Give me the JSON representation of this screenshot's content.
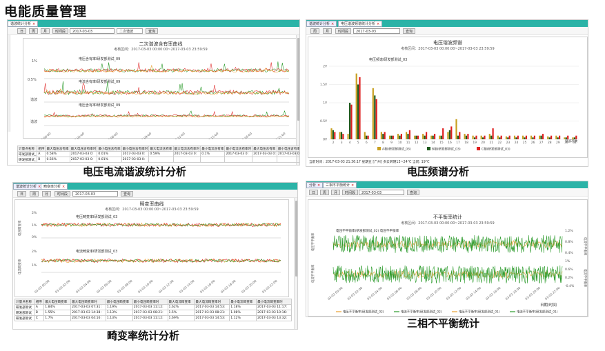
{
  "page_title": "电能质量管理",
  "captions": {
    "p1": "电压电流谐波统计分析",
    "p2": "电压频谱分析",
    "p3": "畸变率统计分析",
    "p4": "三相不平衡统计"
  },
  "toolbar": {
    "day": "日",
    "week": "周",
    "month": "月",
    "period": "时间段",
    "date": "2017-03-03",
    "harmonic_select": "二次谐波",
    "query": "查询"
  },
  "p1": {
    "tabs": [
      "谐波统计分析"
    ],
    "title": "二次谐波含有率曲线",
    "subtitle": "考核区间：2017-03-03 00:00:00~2017-03-03 23:59:59",
    "sub1": "电压含有率I研发部测试_09",
    "sub2": "电流含有率I研发部测试_09",
    "sub3": "电压含有率I研发部测试_09",
    "yticks1": [
      "1%",
      "0.5%"
    ],
    "ylabel2": "谐波",
    "ylabel3": "谐波",
    "xticks": [
      "03-03 00:00",
      "03-03 03:00",
      "03-03 06:00",
      "03-03 09:00",
      "03-03 12:00",
      "03-03 15:00",
      "03-03 18:00",
      "03-03 21:00"
    ],
    "table_headers": [
      "计量点名称",
      "相序",
      "最大电压含有率",
      "最大电压含有率时",
      "最小电压含有率",
      "最小电压含有率时",
      "最大电流含有率",
      "最大电流含有率时",
      "最小电流含有率",
      "最小电流含有率时",
      "最大电压含有率",
      "最小电压含有率"
    ],
    "rows": [
      [
        "研发部测试_",
        "A",
        "0.58%",
        "2017-03-03 0:",
        "0.01%",
        "2017-03-03 0:",
        "0.59%",
        "2017-03-03 0:",
        "0.1%",
        "2017-03-03 0:",
        "2017-03-03 0:",
        "2017-03-03 0:"
      ],
      [
        "研发部测试_",
        "B",
        "0.56%",
        "2017-03-03 0:",
        "0.01%",
        "2017-03-03 0:",
        "",
        "",
        "",
        "",
        "",
        ""
      ]
    ]
  },
  "p2": {
    "tabs": [
      "谐波统计分析",
      "电压谐波频谱统计分析"
    ],
    "title": "电压谐波频谱",
    "subtitle": "考核区间：2017-03-03 00:00:00~2017-03-03 23:59:59",
    "series_label": "电压频谱I研发部测试_03",
    "status": "当前时间：2017-03-03 21:36:17 星期五    [广州] 多云转阴13~24°C 当前: 19°C",
    "xlabel": "谐波次数",
    "legend": [
      "A相(研发部测试_03)",
      "B相(研发部测试_03)",
      "C相(研发部测试_03)"
    ]
  },
  "p3": {
    "tabs": [
      "谐波统计分析",
      "畸变率分析"
    ],
    "title": "畸变率曲线",
    "subtitle": "考核区间：2017-03-03 00:00:00~2017-03-03 23:59:59",
    "sub1": "电压畸变率I研发部测试_03",
    "sub2": "电流畸变率I研发部测试_03",
    "yticks1": [
      "2%",
      "1%",
      "0%"
    ],
    "yticks2": [
      "2%",
      "1%"
    ],
    "ylabel1": "电压畸变率",
    "ylabel2": "电流畸变率",
    "xticks": [
      "03-03 00:00",
      "03-03 02:00",
      "03-03 04:00",
      "03-03 06:00",
      "03-03 08:00",
      "03-03 10:00",
      "03-03 12:00",
      "03-03 14:00",
      "03-03 16:00",
      "03-03 18:00",
      "03-03 20:00",
      "03-03 22:00"
    ],
    "table_headers": [
      "计量点名称",
      "相序",
      "最大电压畸变率",
      "最大电压畸变率时",
      "最小电压畸变率",
      "最小电压畸变率时",
      "最大电流畸变率",
      "最大电流畸变率时",
      "最小电流畸变率",
      "最小电流畸变率时"
    ],
    "rows": [
      [
        "研发部测试",
        "A",
        "1.84%",
        "2017-03-03 07:31:",
        "1.19%",
        "2017-03-03 11:12:",
        "1.62%",
        "2017-03-03 14:53:",
        "1.18%",
        "2017-03-03 11:17:"
      ],
      [
        "研发部测试",
        "B",
        "1.55%",
        "2017-03-03 14:38:",
        "1.13%",
        "2017-03-03 08:21:",
        "1.5%",
        "2017-03-03 08:21:",
        "1.08%",
        "2017-03-03 10:16:"
      ],
      [
        "研发部测试",
        "C",
        "1.7%",
        "2017-03-03 04:16:",
        "1.13%",
        "2017-03-03 11:12:",
        "1.69%",
        "2017-03-03 14:53:",
        "1.12%",
        "2017-03-03 13:32:"
      ]
    ]
  },
  "p4": {
    "tabs": [
      "分析",
      "三相不平衡统计"
    ],
    "title": "不平衡率统计",
    "subtitle": "考核区间：2017-03-03 00:00:00~2017-03-03 23:59:59",
    "sub1": "电压不平衡率(研发部测试_02) 电压不平衡率",
    "ylabel_left1": "电压不平衡率",
    "ylabel_left2": "电流不平衡率",
    "ylabel_right1": "电流不平衡率",
    "ylabel_right2": "电流不平衡率",
    "yticks_r1": [
      "1.2%",
      "0.8%",
      "0.4%"
    ],
    "yticks_r2": [
      "1%",
      "0.6%",
      "0.2%",
      "-0.4%"
    ],
    "xticks": [
      "03-03 00:00",
      "03-03 02:00",
      "03-03 04:00",
      "03-03 06:00",
      "03-03 08:00",
      "03-03 10:00",
      "03-03 12:00",
      "03-03 14:00",
      "03-03 16:00",
      "03-03 18:00",
      "03-03 20:00",
      "03-03 22:00"
    ],
    "xlabel": "日期/时间",
    "legend": [
      "电压不平衡率(研发部测试_02)",
      "电流不平衡率(研发部测试_02)",
      "电压不平衡率(研发部测试_01)",
      "电流不平衡率(研发部测试_01)"
    ]
  },
  "colors": {
    "tabbar": "#2bb3a7",
    "phaseA": "#c8a020",
    "phaseB": "#1e5a1e",
    "phaseC": "#e02020",
    "lineGreen": "#2a9a2a",
    "lineRed": "#e03030",
    "lineOrange": "#e8a030"
  },
  "chart_data": [
    {
      "type": "line",
      "title": "二次谐波含有率曲线",
      "series": [
        {
          "name": "电压含有率I研发部测试_09",
          "values": [
            0.6,
            0.62,
            0.61,
            0.63,
            0.6,
            0.85,
            0.62,
            0.61,
            0.6,
            0.62,
            0.63,
            0.61,
            0.6,
            0.62,
            0.6,
            0.61
          ]
        },
        {
          "name": "电流含有率I研发部测试_09",
          "values": [
            0.5,
            0.52,
            0.55,
            0.51,
            0.53,
            0.7,
            0.52,
            0.5,
            0.51,
            0.6,
            0.52,
            0.5,
            0.53,
            0.51,
            0.5,
            0.52
          ]
        }
      ]
    },
    {
      "type": "bar",
      "title": "电压谐波频谱",
      "categories": [
        "2",
        "3",
        "4",
        "5",
        "6",
        "7",
        "8",
        "9",
        "10",
        "11",
        "12",
        "13",
        "14",
        "15",
        "16",
        "17",
        "18",
        "19",
        "20",
        "21",
        "22",
        "23",
        "24",
        "25",
        "26",
        "27",
        "28",
        "29",
        "30",
        "31"
      ],
      "ylim": [
        0,
        2
      ],
      "series": [
        {
          "name": "A相(研发部测试_03)",
          "values": [
            0.3,
            0.2,
            0.15,
            1.8,
            0.2,
            1.4,
            0.2,
            0.1,
            0.15,
            0.2,
            0.1,
            0.15,
            0.1,
            0.1,
            0.2,
            0.55,
            0.15,
            0.1,
            0.1,
            0.15,
            0.1,
            0.08,
            0.1,
            0.1,
            0.1,
            0.1,
            0.08,
            0.1,
            0.05,
            0.05
          ]
        },
        {
          "name": "B相(研发部测试_03)",
          "values": [
            0.25,
            0.2,
            1.0,
            1.5,
            0.1,
            1.2,
            0.15,
            0.1,
            0.1,
            0.15,
            0.1,
            0.1,
            0.1,
            0.1,
            0.25,
            0.1,
            0.1,
            0.05,
            0.05,
            0.1,
            0.05,
            0.05,
            0.05,
            0.05,
            0.05,
            0.1,
            0.05,
            0.05,
            0.05,
            0.05
          ]
        },
        {
          "name": "C相(研发部测试_03)",
          "values": [
            0.2,
            0.15,
            0.95,
            1.7,
            0.1,
            1.1,
            0.2,
            0.1,
            0.15,
            0.25,
            0.1,
            0.2,
            0.15,
            0.3,
            0.35,
            0.2,
            0.15,
            0.1,
            0.1,
            0.3,
            0.1,
            0.1,
            0.1,
            0.1,
            0.1,
            0.15,
            0.1,
            0.1,
            0.1,
            0.1
          ]
        }
      ]
    },
    {
      "type": "line",
      "title": "畸变率曲线",
      "series": [
        {
          "name": "电压畸变率I研发部测试_03",
          "values": [
            1.4,
            1.45,
            1.42,
            1.5,
            1.44,
            1.43,
            1.46,
            1.41,
            1.45,
            1.44,
            1.42,
            1.43
          ]
        },
        {
          "name": "电流畸变率I研发部测试_03",
          "values": [
            1.3,
            1.35,
            1.32,
            1.36,
            1.31,
            1.33,
            1.34,
            1.3,
            1.35,
            1.32,
            1.33,
            1.31
          ]
        }
      ]
    },
    {
      "type": "line",
      "title": "不平衡率统计",
      "series": [
        {
          "name": "电压不平衡率(研发部测试_02)",
          "values": [
            0.6,
            0.8,
            0.5,
            0.9,
            0.6,
            0.8,
            0.5,
            0.9
          ]
        },
        {
          "name": "电流不平衡率(研发部测试_01)",
          "values": [
            0.4,
            0.7,
            0.3,
            0.8,
            0.4,
            0.6,
            0.3,
            0.7
          ]
        }
      ]
    }
  ]
}
